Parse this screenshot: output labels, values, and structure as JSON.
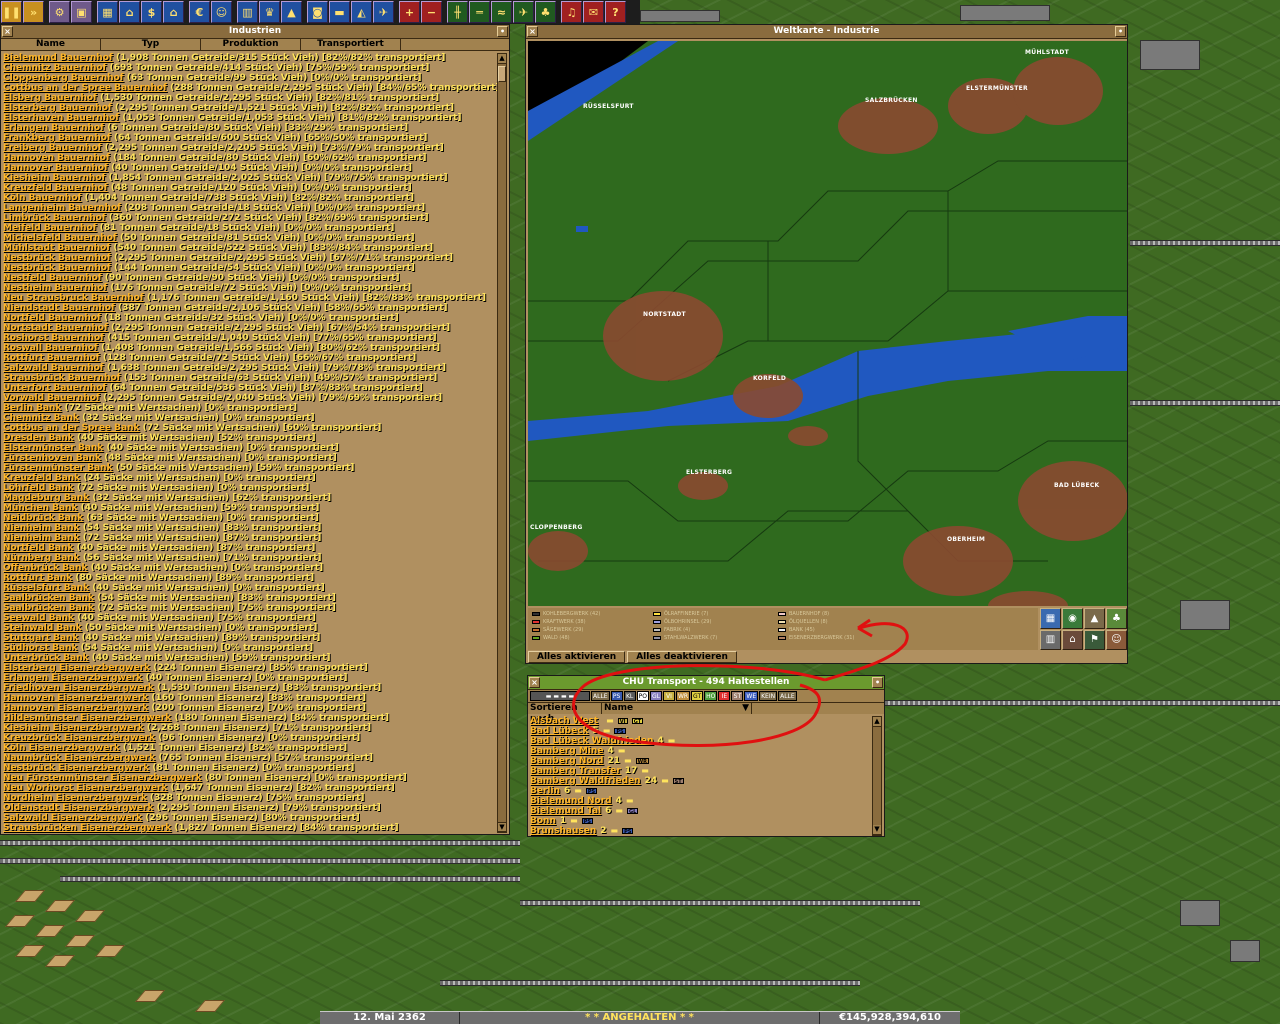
{
  "toolbar": {
    "buttons": [
      "pause-button",
      "fast-forward-button",
      "settings-button",
      "save-button",
      "town-directory-button",
      "subsidies-button",
      "stations-button",
      "finances-button",
      "company-button",
      "graphs-button",
      "league-button",
      "industries-button",
      "trains-button",
      "road-vehicles-button",
      "ships-button",
      "aircraft-button",
      "zoom-in-button",
      "zoom-out-button",
      "build-rail-button",
      "build-road-button",
      "build-water-button",
      "build-airport-button",
      "landscape-button",
      "music-button",
      "news-button",
      "help-button"
    ]
  },
  "industries_window": {
    "title": "Industrien",
    "columns": [
      "Name",
      "Typ",
      "Produktion",
      "Transportiert"
    ],
    "rows": [
      {
        "name": "Bielemund Bauernhof",
        "info": "(1,908 Tonnen Getreide/315 Stück Vieh) [82%/82% transportiert]"
      },
      {
        "name": "Chemnitz Bauernhof",
        "info": "(693 Tonnen Getreide/414 Stück Vieh) [75%/59% transportiert]"
      },
      {
        "name": "Cloppenberg Bauernhof",
        "info": "(63 Tonnen Getreide/99 Stück Vieh) [0%/0% transportiert]"
      },
      {
        "name": "Cottbus an der Spree Bauernhof",
        "info": "(288 Tonnen Getreide/2,295 Stück Vieh) [84%/65% transportiert]"
      },
      {
        "name": "Elsberg Bauernhof",
        "info": "(1,530 Tonnen Getreide/2,295 Stück Vieh) [82%/81% transportiert]"
      },
      {
        "name": "Elsterberg Bauernhof",
        "info": "(2,295 Tonnen Getreide/1,521 Stück Vieh) [82%/82% transportiert]"
      },
      {
        "name": "Elsterhaven Bauernhof",
        "info": "(1,053 Tonnen Getreide/1,053 Stück Vieh) [81%/82% transportiert]"
      },
      {
        "name": "Erlangen Bauernhof",
        "info": "(6 Tonnen Getreide/80 Stück Vieh) [33%/29% transportiert]"
      },
      {
        "name": "Frankberg Bauernhof",
        "info": "(64 Tonnen Getreide/600 Stück Vieh) [65%/50% transportiert]"
      },
      {
        "name": "Freiberg Bauernhof",
        "info": "(2,295 Tonnen Getreide/2,205 Stück Vieh) [73%/79% transportiert]"
      },
      {
        "name": "Hannoven Bauernhof",
        "info": "(184 Tonnen Getreide/80 Stück Vieh) [60%/62% transportiert]"
      },
      {
        "name": "Hannover Bauernhof",
        "info": "(40 Tonnen Getreide/104 Stück Vieh) [0%/0% transportiert]"
      },
      {
        "name": "Kiesheim Bauernhof",
        "info": "(1,854 Tonnen Getreide/2,025 Stück Vieh) [79%/75% transportiert]"
      },
      {
        "name": "Kreuzfeld Bauernhof",
        "info": "(48 Tonnen Getreide/120 Stück Vieh) [0%/0% transportiert]"
      },
      {
        "name": "Köln Bauernhof",
        "info": "(1,404 Tonnen Getreide/738 Stück Vieh) [82%/82% transportiert]"
      },
      {
        "name": "Langenheim Bauernhof",
        "info": "(208 Tonnen Getreide/18 Stück Vieh) [0%/0% transportiert]"
      },
      {
        "name": "Limbrück Bauernhof",
        "info": "(360 Tonnen Getreide/272 Stück Vieh) [82%/69% transportiert]"
      },
      {
        "name": "Meifeld Bauernhof",
        "info": "(81 Tonnen Getreide/18 Stück Vieh) [0%/0% transportiert]"
      },
      {
        "name": "Michelsfeld Bauernhof",
        "info": "(50 Tonnen Getreide/81 Stück Vieh) [0%/0% transportiert]"
      },
      {
        "name": "Mühlstadt Bauernhof",
        "info": "(540 Tonnen Getreide/522 Stück Vieh) [83%/84% transportiert]"
      },
      {
        "name": "Nestbrück Bauernhof",
        "info": "(2,295 Tonnen Getreide/2,295 Stück Vieh) [67%/71% transportiert]"
      },
      {
        "name": "Nestbrück Bauernhof",
        "info": "(144 Tonnen Getreide/54 Stück Vieh) [0%/0% transportiert]"
      },
      {
        "name": "Nestfeld Bauernhof",
        "info": "(90 Tonnen Getreide/90 Stück Vieh) [0%/0% transportiert]"
      },
      {
        "name": "Nestheim Bauernhof",
        "info": "(176 Tonnen Getreide/72 Stück Vieh) [0%/0% transportiert]"
      },
      {
        "name": "Neu Strausbruck Bauernhof",
        "info": "(1,176 Tonnen Getreide/1,160 Stück Vieh) [82%/83% transportiert]"
      },
      {
        "name": "Niendstadt Bauernhof",
        "info": "(387 Tonnen Getreide/2,106 Stück Vieh) [58%/65% transportiert]"
      },
      {
        "name": "Nortfeld Bauernhof",
        "info": "(18 Tonnen Getreide/32 Stück Vieh) [0%/0% transportiert]"
      },
      {
        "name": "Nortstadt Bauernhof",
        "info": "(2,295 Tonnen Getreide/2,295 Stück Vieh) [67%/54% transportiert]"
      },
      {
        "name": "Roshorst Bauernhof",
        "info": "(415 Tonnen Getreide/1,040 Stück Vieh) [77%/65% transportiert]"
      },
      {
        "name": "Roswall Bauernhof",
        "info": "(1,408 Tonnen Getreide/1,566 Stück Vieh) [80%/62% transportiert]"
      },
      {
        "name": "Rottfurt Bauernhof",
        "info": "(128 Tonnen Getreide/72 Stück Vieh) [66%/67% transportiert]"
      },
      {
        "name": "Salzwald Bauernhof",
        "info": "(1,638 Tonnen Getreide/2,295 Stück Vieh) [79%/78% transportiert]"
      },
      {
        "name": "Strausbrück Bauernhof",
        "info": "(153 Tonnen Getreide/63 Stück Vieh) [49%/57% transportiert]"
      },
      {
        "name": "Unterfort Bauernhof",
        "info": "(64 Tonnen Getreide/536 Stück Vieh) [87%/83% transportiert]"
      },
      {
        "name": "Vorwald Bauernhof",
        "info": "(2,295 Tonnen Getreide/2,040 Stück Vieh) [79%/69% transportiert]"
      },
      {
        "name": "Berlin Bank",
        "info": "(72 Säcke mit Wertsachen) [0% transportiert]"
      },
      {
        "name": "Chemnitz Bank",
        "info": "(32 Säcke mit Wertsachen) [0% transportiert]"
      },
      {
        "name": "Cottbus an der Spree Bank",
        "info": "(72 Säcke mit Wertsachen) [60% transportiert]"
      },
      {
        "name": "Dresden Bank",
        "info": "(40 Säcke mit Wertsachen) [52% transportiert]"
      },
      {
        "name": "Elstermünster Bank",
        "info": "(40 Säcke mit Wertsachen) [0% transportiert]"
      },
      {
        "name": "Fürstenhoven Bank",
        "info": "(48 Säcke mit Wertsachen) [0% transportiert]"
      },
      {
        "name": "Fürstenmünster Bank",
        "info": "(50 Säcke mit Wertsachen) [59% transportiert]"
      },
      {
        "name": "Kreuzfeld Bank",
        "info": "(24 Säcke mit Wertsachen) [0% transportiert]"
      },
      {
        "name": "Löhrfeld Bank",
        "info": "(72 Säcke mit Wertsachen) [0% transportiert]"
      },
      {
        "name": "Magdeburg Bank",
        "info": "(32 Säcke mit Wertsachen) [62% transportiert]"
      },
      {
        "name": "München Bank",
        "info": "(40 Säcke mit Wertsachen) [59% transportiert]"
      },
      {
        "name": "Neidbrück Bank",
        "info": "(63 Säcke mit Wertsachen) [0% transportiert]"
      },
      {
        "name": "Nienheim Bank",
        "info": "(54 Säcke mit Wertsachen) [83% transportiert]"
      },
      {
        "name": "Nienheim Bank",
        "info": "(72 Säcke mit Wertsachen) [87% transportiert]"
      },
      {
        "name": "Nortfeld Bank",
        "info": "(40 Säcke mit Wertsachen) [87% transportiert]"
      },
      {
        "name": "Nürnberg Bank",
        "info": "(56 Säcke mit Wertsachen) [71% transportiert]"
      },
      {
        "name": "Offenbrück Bank",
        "info": "(40 Säcke mit Wertsachen) [0% transportiert]"
      },
      {
        "name": "Rottfurt Bank",
        "info": "(80 Säcke mit Wertsachen) [89% transportiert]"
      },
      {
        "name": "Rüsselsfurt Bank",
        "info": "(40 Säcke mit Wertsachen) [0% transportiert]"
      },
      {
        "name": "Saalbrücken Bank",
        "info": "(54 Säcke mit Wertsachen) [83% transportiert]"
      },
      {
        "name": "Saalbrücken Bank",
        "info": "(72 Säcke mit Wertsachen) [75% transportiert]"
      },
      {
        "name": "Seewald Bank",
        "info": "(40 Säcke mit Wertsachen) [75% transportiert]"
      },
      {
        "name": "Steinwald Bank",
        "info": "(50 Säcke mit Wertsachen) [0% transportiert]"
      },
      {
        "name": "Stuttgart Bank",
        "info": "(40 Säcke mit Wertsachen) [89% transportiert]"
      },
      {
        "name": "Südhorst Bank",
        "info": "(54 Säcke mit Wertsachen) [0% transportiert]"
      },
      {
        "name": "Unterbrück Bank",
        "info": "(40 Säcke mit Wertsachen) [59% transportiert]"
      },
      {
        "name": "Elsterberg Eisenerzbergwerk",
        "info": "(224 Tonnen Eisenerz) [85% transportiert]"
      },
      {
        "name": "Erlangen Eisenerzbergwerk",
        "info": "(40 Tonnen Eisenerz) [0% transportiert]"
      },
      {
        "name": "Friedhoven Eisenerzbergwerk",
        "info": "(1,530 Tonnen Eisenerz) [83% transportiert]"
      },
      {
        "name": "Hannoven Eisenerzbergwerk",
        "info": "(160 Tonnen Eisenerz) [83% transportiert]"
      },
      {
        "name": "Hannoven Eisenerzbergwerk",
        "info": "(200 Tonnen Eisenerz) [70% transportiert]"
      },
      {
        "name": "Hildesmünster Eisenerzbergwerk",
        "info": "(180 Tonnen Eisenerz) [84% transportiert]"
      },
      {
        "name": "Kiesheim Eisenerzbergwerk",
        "info": "(2,268 Tonnen Eisenerz) [71% transportiert]"
      },
      {
        "name": "Kreuzbrück Eisenerzbergwerk",
        "info": "(96 Tonnen Eisenerz) [0% transportiert]"
      },
      {
        "name": "Köln Eisenerzbergwerk",
        "info": "(1,521 Tonnen Eisenerz) [82% transportiert]"
      },
      {
        "name": "Naumbrück Eisenerzbergwerk",
        "info": "(765 Tonnen Eisenerz) [57% transportiert]"
      },
      {
        "name": "Nestbrück Eisenerzbergwerk",
        "info": "(81 Tonnen Eisenerz) [0% transportiert]"
      },
      {
        "name": "Neu Fürstenmünster Eisenerzbergwerk",
        "info": "(80 Tonnen Eisenerz) [0% transportiert]"
      },
      {
        "name": "Neu Worhorst Eisenerzbergwerk",
        "info": "(1,647 Tonnen Eisenerz) [82% transportiert]"
      },
      {
        "name": "Nordheim Eisenerzbergwerk",
        "info": "(328 Tonnen Eisenerz) [75% transportiert]"
      },
      {
        "name": "Oldenstadt Eisenerzbergwerk",
        "info": "(2,295 Tonnen Eisenerz) [79% transportiert]"
      },
      {
        "name": "Salzwald Eisenerzbergwerk",
        "info": "(296 Tonnen Eisenerz) [80% transportiert]"
      },
      {
        "name": "Strausbrücken Eisenerzbergwerk",
        "info": "(1,827 Tonnen Eisenerz) [84% transportiert]"
      }
    ]
  },
  "map_window": {
    "title": "Weltkarte - Industrie",
    "towns": [
      {
        "label": "MÜHLSTADT"
      },
      {
        "label": "RÜSSELSFURT"
      },
      {
        "label": "SALZBRÜCKEN"
      },
      {
        "label": "ELSTERMÜNSTER"
      },
      {
        "label": "NORTSTADT"
      },
      {
        "label": "KORFELD"
      },
      {
        "label": "ELSTERBERG"
      },
      {
        "label": "BAD LÜBECK"
      },
      {
        "label": "CLOPPENBERG"
      },
      {
        "label": "OBERHEIM"
      }
    ],
    "legend": [
      {
        "label": "KOHLEBERGWERK (42)",
        "color": "#303030"
      },
      {
        "label": "KRAFTWERK (38)",
        "color": "#e03030"
      },
      {
        "label": "SÄGEWERK (29)",
        "color": "#c07030"
      },
      {
        "label": "WALD (48)",
        "color": "#60a020"
      },
      {
        "label": "ÖLRAFFINERIE (7)",
        "color": "#ffe040"
      },
      {
        "label": "ÖLBOHRINSEL (29)",
        "color": "#a0a0e0"
      },
      {
        "label": "FABRIK (4)",
        "color": "#c0c0c0"
      },
      {
        "label": "STAHLWALZWERK (7)",
        "color": "#9090a0"
      },
      {
        "label": "BAUERNHOF (8)",
        "color": "#f0c8c8"
      },
      {
        "label": "ÖLQUELLEN (8)",
        "color": "#f0e0b0"
      },
      {
        "label": "BANK (45)",
        "color": "#f0f0f0"
      },
      {
        "label": "EISENERZBERGWERK (31)",
        "color": "#b08060"
      }
    ],
    "enable_all": "Alles aktivieren",
    "disable_all": "Alles deaktivieren"
  },
  "stations_window": {
    "title": "CHU Transport - 494 Haltestellen",
    "filters": [
      "ALLE",
      "PS",
      "KL",
      "PO",
      "GL",
      "VI",
      "WR",
      "GT",
      "HO",
      "IE",
      "ST",
      "WE",
      "KEIN",
      "ALLE"
    ],
    "sort_label": "Sortieren nach",
    "sort_value": "Name",
    "stations": [
      {
        "name": "Alsbach West",
        "count": "",
        "cargo": [
          "VI",
          "GT"
        ]
      },
      {
        "name": "Bad Lübeck",
        "count": "5",
        "cargo": [
          "PS"
        ]
      },
      {
        "name": "Bad Lübeck Waldfrieden",
        "count": "4",
        "cargo": []
      },
      {
        "name": "Bamberg Mine",
        "count": "4",
        "cargo": []
      },
      {
        "name": "Bamberg Nord",
        "count": "21",
        "cargo": [
          "WR"
        ]
      },
      {
        "name": "Bamberg Transfer",
        "count": "17",
        "cargo": []
      },
      {
        "name": "Bamberg Waldfrieden",
        "count": "24",
        "cargo": [
          "ST"
        ]
      },
      {
        "name": "Berlin",
        "count": "6",
        "cargo": [
          "PS"
        ]
      },
      {
        "name": "Bielemund Nord",
        "count": "4",
        "cargo": []
      },
      {
        "name": "Bielemund Tal",
        "count": "6",
        "cargo": [
          "GL"
        ]
      },
      {
        "name": "Bonn",
        "count": "1",
        "cargo": [
          "PS"
        ]
      },
      {
        "name": "Brunshausen",
        "count": "2",
        "cargo": [
          "PS"
        ]
      }
    ]
  },
  "statusbar": {
    "date": "12. Mai 2362",
    "message": "* * ANGEHALTEN * *",
    "money": "€145,928,394,610"
  },
  "colors": {
    "panel": "#b09060",
    "industry_name": "#ffb627",
    "industry_info": "#ffe35c",
    "annotation": "#e01010"
  }
}
